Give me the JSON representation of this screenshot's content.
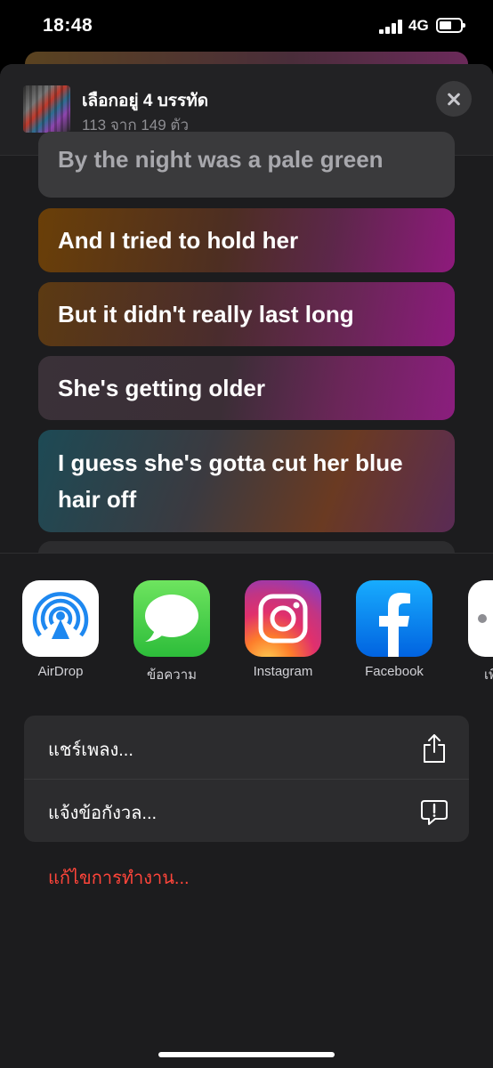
{
  "status_bar": {
    "time": "18:48",
    "network": "4G"
  },
  "header": {
    "title": "เลือกอยู่ 4 บรรทัด",
    "subtitle": "113 จาก 149 ตัว"
  },
  "lyrics": [
    "By the night was a pale green",
    "And I tried to hold her",
    "But it didn't really last long",
    "She's getting older",
    "I guess she's gotta cut her blue hair off"
  ],
  "share_apps": [
    {
      "label": "AirDrop",
      "icon": "airdrop-icon"
    },
    {
      "label": "ข้อความ",
      "icon": "messages-icon"
    },
    {
      "label": "Instagram",
      "icon": "instagram-icon"
    },
    {
      "label": "Facebook",
      "icon": "facebook-icon"
    },
    {
      "label": "เพิ่",
      "icon": "more-icon"
    }
  ],
  "actions": [
    {
      "label": "แชร์เพลง...",
      "icon": "share-icon"
    },
    {
      "label": "แจ้งข้อกังวล...",
      "icon": "report-bubble-icon"
    }
  ],
  "edit_actions_label": "แก้ไขการทำงาน...",
  "colors": {
    "sheet_bg": "#1c1c1e",
    "destructive": "#ff453a"
  }
}
